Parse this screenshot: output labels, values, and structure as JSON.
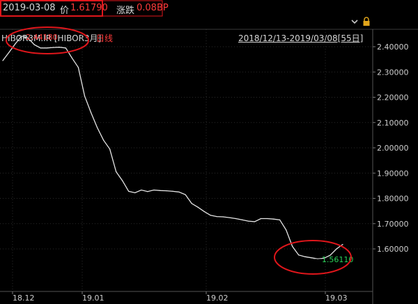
{
  "header": {
    "date": "2019-03-08",
    "price_label": "价",
    "price_value": "1.61790",
    "change_label": "涨跌",
    "change_value": "0.08BP",
    "symbol": "HIBOR3M.IR [HIBOR3月]",
    "period": "日线",
    "range": "2018/12/13-2019/03/08[55日]"
  },
  "colors": {
    "background": "#000000",
    "line": "#e6e6e6",
    "grid": "#2a2a2a",
    "highlight_box": "#e0161b",
    "rise": "#ff3b3b",
    "fall": "#2bd45a"
  },
  "icons": [
    "collapse-icon",
    "lock-icon"
  ],
  "chart_data": {
    "type": "line",
    "title": "",
    "xlabel": "",
    "ylabel": "",
    "x_ticks": [
      "18.12",
      "19.01",
      "19.02",
      "19.03"
    ],
    "y_ticks": [
      "2.40000",
      "2.30000",
      "2.20000",
      "2.10000",
      "2.00000",
      "1.90000",
      "1.80000",
      "1.70000",
      "1.60000"
    ],
    "ylim": [
      1.535,
      2.46
    ],
    "grid": true,
    "annotations": [
      {
        "label": "2.44180",
        "value": 2.4418,
        "kind": "max"
      },
      {
        "label": "1.56110",
        "value": 1.5611,
        "kind": "min"
      }
    ],
    "series": [
      {
        "values": [
          2.345,
          2.378,
          2.412,
          2.4418,
          2.435,
          2.408,
          2.395,
          2.395,
          2.397,
          2.398,
          2.395,
          2.355,
          2.318,
          2.205,
          2.14,
          2.08,
          2.03,
          1.995,
          1.905,
          1.87,
          1.828,
          1.822,
          1.833,
          1.827,
          1.833,
          1.831,
          1.83,
          1.828,
          1.825,
          1.815,
          1.78,
          1.765,
          1.748,
          1.733,
          1.728,
          1.727,
          1.724,
          1.72,
          1.715,
          1.71,
          1.708,
          1.72,
          1.72,
          1.718,
          1.715,
          1.675,
          1.61,
          1.576,
          1.569,
          1.565,
          1.5611,
          1.563,
          1.575,
          1.6,
          1.6179
        ]
      }
    ]
  }
}
